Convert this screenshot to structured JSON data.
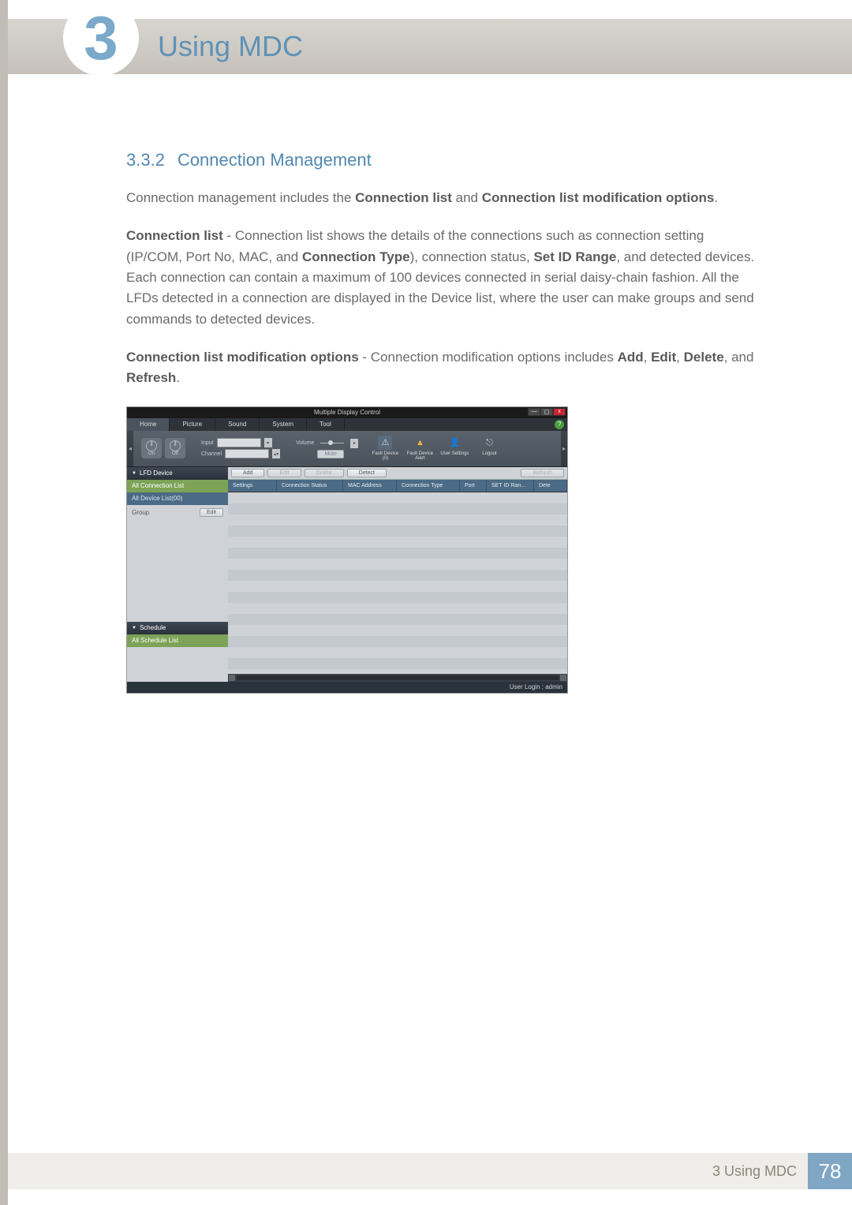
{
  "chapter": {
    "number": "3",
    "title": "Using MDC"
  },
  "section": {
    "number": "3.3.2",
    "heading": "Connection Management",
    "intro": "Connection management includes the ",
    "intro_bold1": "Connection list",
    "intro_mid": " and ",
    "intro_bold2": "Connection list modification options",
    "intro_end": ".",
    "p2_lead": "Connection list",
    "p2_a": " - Connection list shows the details of the connections such as connection setting (IP/COM, Port No, MAC, and ",
    "p2_bold_ct": "Connection Type",
    "p2_b": "), connection status, ",
    "p2_bold_sid": "Set ID Range",
    "p2_c": ", and detected devices. Each connection can contain a maximum of 100 devices connected in serial daisy-chain fashion. All the LFDs detected in a connection are displayed in the Device list, where the user can make groups and send commands to detected devices.",
    "p3_lead": "Connection list modification options",
    "p3_a": " - Connection modification options includes ",
    "p3_add": "Add",
    "p3_s1": ", ",
    "p3_edit": "Edit",
    "p3_s2": ", ",
    "p3_delete": "Delete",
    "p3_s3": ", and ",
    "p3_refresh": "Refresh",
    "p3_end": "."
  },
  "app": {
    "title": "Multiple Display Control",
    "win": {
      "min": "—",
      "max": "▢",
      "close": "x"
    },
    "help": "?",
    "menu": {
      "home": "Home",
      "picture": "Picture",
      "sound": "Sound",
      "system": "System",
      "tool": "Tool"
    },
    "toolbar": {
      "nav_left": "◂",
      "nav_right": "▸",
      "on": "On",
      "off": "Off",
      "input": "Input",
      "channel": "Channel",
      "volume": "Volume",
      "mute": "Mute",
      "fault0": "Fault Device (0)",
      "fault_alert": "Fault Device Alert",
      "user_settings": "User Settings",
      "logout": "Logout"
    },
    "sidebar": {
      "lfd_header": "LFD Device",
      "all_connection_list": "All Connection List",
      "all_device_list": "All Device List(00)",
      "group": "Group",
      "edit": "Edit",
      "schedule_header": "Schedule",
      "all_schedule_list": "All Schedule List"
    },
    "actions": {
      "add": "Add",
      "edit": "Edit",
      "delete": "Delete",
      "detect": "Detect",
      "refresh": "Refresh"
    },
    "columns": {
      "settings": "Settings",
      "connection_status": "Connection Status",
      "mac": "MAC Address",
      "connection_type": "Connection Type",
      "port": "Port",
      "set_id_range": "SET ID Ran…",
      "dete": "Dete"
    },
    "status": "User Login : admin"
  },
  "footer": {
    "label": "3 Using MDC",
    "page": "78"
  }
}
